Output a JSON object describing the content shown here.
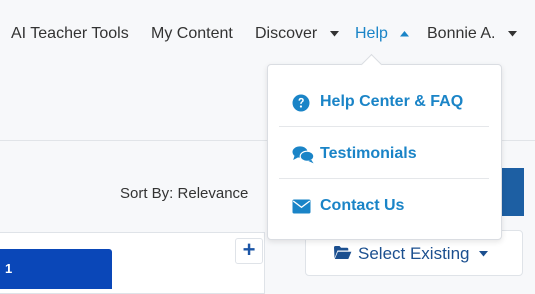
{
  "nav": {
    "items": [
      {
        "label": "AI Teacher Tools"
      },
      {
        "label": "My Content"
      },
      {
        "label": "Discover"
      },
      {
        "label": "Help"
      },
      {
        "label": "Bonnie A."
      }
    ],
    "active_color": "#1a84c7"
  },
  "help_menu": {
    "items": [
      {
        "label": "Help Center & FAQ",
        "icon": "question-circle-icon"
      },
      {
        "label": "Testimonials",
        "icon": "comments-icon"
      },
      {
        "label": "Contact Us",
        "icon": "envelope-icon"
      }
    ]
  },
  "toolbar": {
    "sort_label": "Sort By: Relevance"
  },
  "card": {
    "tab_text": "1",
    "add_label": "+"
  },
  "folder_panel": {
    "select_existing_label": "Select Existing"
  },
  "colors": {
    "accent": "#1a84c7",
    "primary_button": "#1d5fa3",
    "card_tab": "#0a47b8"
  }
}
